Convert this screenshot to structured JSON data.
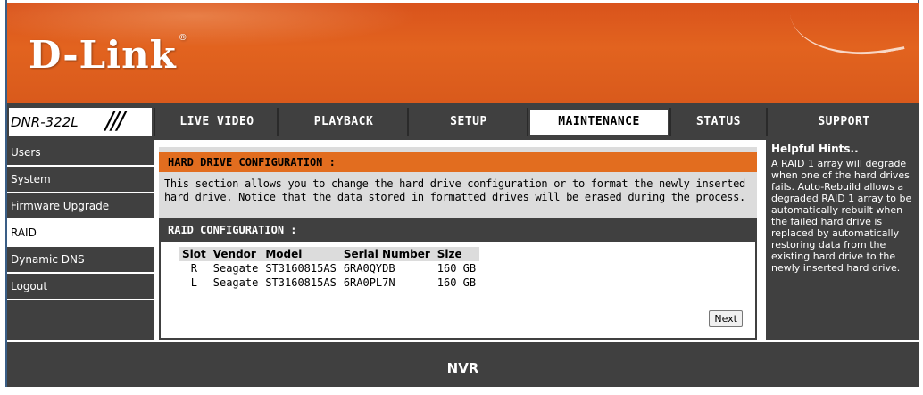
{
  "brand": {
    "logo": "D-Link",
    "trademark": "®"
  },
  "model": {
    "name": "DNR-322L",
    "slashes": "///"
  },
  "nav": {
    "tabs": [
      {
        "label": "LIVE VIDEO",
        "active": false
      },
      {
        "label": "PLAYBACK",
        "active": false
      },
      {
        "label": "SETUP",
        "active": false
      },
      {
        "label": "MAINTENANCE",
        "active": true
      },
      {
        "label": "STATUS",
        "active": false
      },
      {
        "label": "SUPPORT",
        "active": false
      }
    ]
  },
  "sidebar": {
    "items": [
      {
        "label": "Users",
        "active": false
      },
      {
        "label": "System",
        "active": false
      },
      {
        "label": "Firmware Upgrade",
        "active": false
      },
      {
        "label": "RAID",
        "active": true
      },
      {
        "label": "Dynamic DNS",
        "active": false
      },
      {
        "label": "Logout",
        "active": false
      }
    ]
  },
  "hard_drive": {
    "title": "HARD DRIVE CONFIGURATION :",
    "description_line1": "This section allows you to change the hard drive configuration or to format the newly inserted",
    "description_line2": "hard drive. Notice that the data stored in formatted drives will be erased during the process."
  },
  "raid": {
    "title": "RAID CONFIGURATION :",
    "headers": [
      "Slot",
      "Vendor",
      "Model",
      "Serial Number",
      "Size"
    ],
    "rows": [
      [
        "R",
        "Seagate",
        "ST3160815AS",
        "6RA0QYDB",
        "160 GB"
      ],
      [
        "L",
        "Seagate",
        "ST3160815AS",
        "6RA0PL7N",
        "160 GB"
      ]
    ],
    "next_label": "Next"
  },
  "hints": {
    "title": "Helpful Hints..",
    "text": "A RAID 1 array will degrade when one of the hard drives fails. Auto-Rebuild allows a degraded RAID 1 array to be automatically rebuilt when the failed hard drive is replaced by automatically restoring data from the existing hard drive to the newly inserted hard drive."
  },
  "footer": {
    "label": "NVR"
  },
  "colors": {
    "accent": "#e26d1f",
    "dark": "#404040",
    "light": "#dcdcdc"
  }
}
